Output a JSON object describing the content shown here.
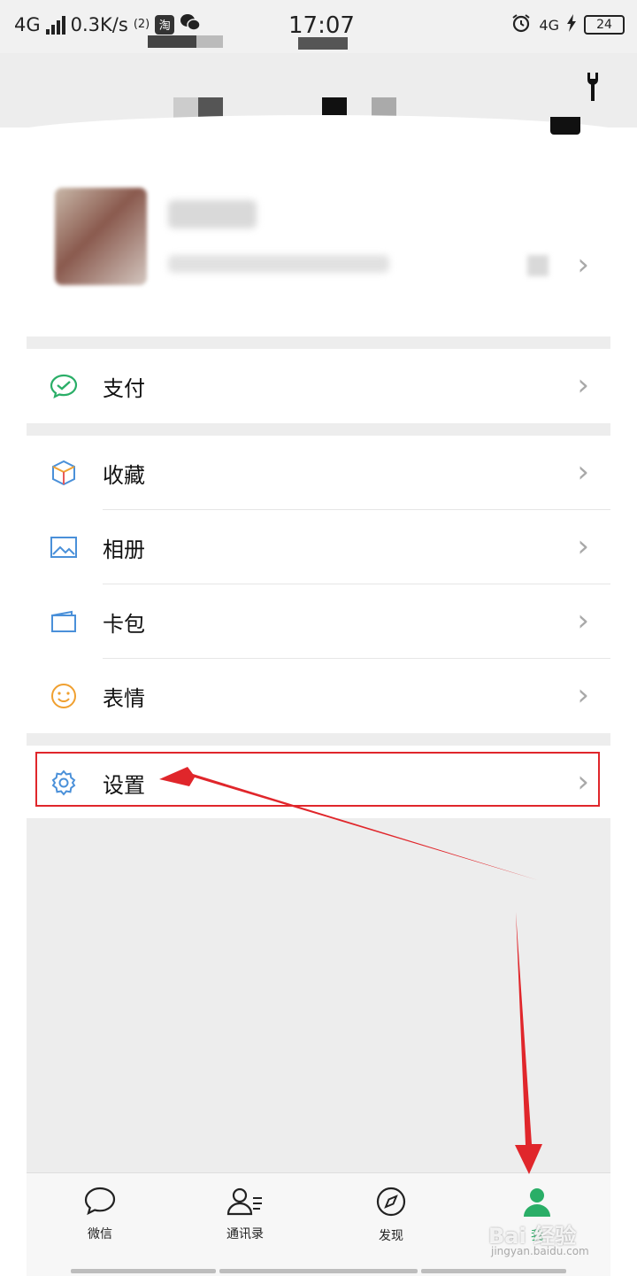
{
  "status_bar": {
    "network": "4G",
    "speed": "0.3K/s",
    "hd_badge": "(2)",
    "taobao_icon_text": "淘",
    "time": "17:07",
    "net_right": "4G",
    "battery": "24"
  },
  "menu": {
    "pay": "支付",
    "favorites": "收藏",
    "album": "相册",
    "cards": "卡包",
    "stickers": "表情",
    "settings": "设置"
  },
  "tabbar": {
    "chats": "微信",
    "contacts": "通讯录",
    "discover": "发现",
    "me": "我"
  },
  "watermark": {
    "brand": "Bai 经验",
    "url": "jingyan.baidu.com"
  },
  "colors": {
    "accent_green": "#2aae67",
    "annotation_red": "#e0262b",
    "background_gray": "#ededed"
  },
  "icons": {
    "pay": "wechat-pay-icon",
    "favorites": "cube-icon",
    "album": "image-icon",
    "cards": "wallet-icon",
    "stickers": "smiley-icon",
    "settings": "gear-icon"
  }
}
